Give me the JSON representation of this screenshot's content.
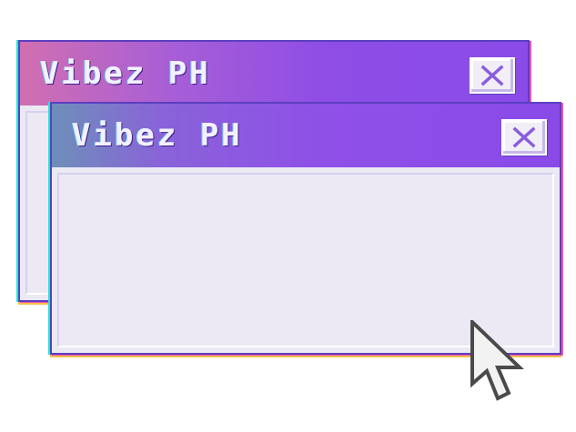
{
  "windows": [
    {
      "title": "Vibez PH",
      "close_icon": "close-icon",
      "content": ""
    },
    {
      "title": "Vibez PH",
      "close_icon": "close-icon",
      "content": ""
    }
  ],
  "cursor_icon": "pointer-arrow-icon",
  "colors": {
    "titlebar_purple": "#8a4be8",
    "window_body": "#ebe9f3",
    "title_text": "#f4f0ff",
    "close_x": "#8a5ce0"
  }
}
